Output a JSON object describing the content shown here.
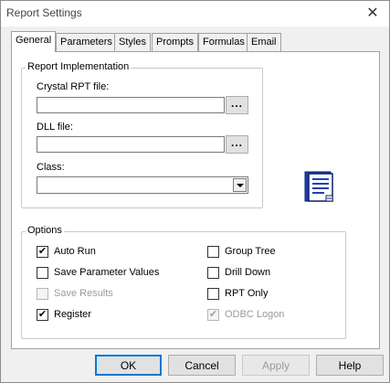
{
  "window": {
    "title": "Report Settings",
    "close_glyph": "✕"
  },
  "tabs": [
    {
      "label": "General",
      "active": true
    },
    {
      "label": "Parameters"
    },
    {
      "label": "Styles"
    },
    {
      "label": "Prompts"
    },
    {
      "label": "Formulas"
    },
    {
      "label": "Email"
    }
  ],
  "implementation": {
    "legend": "Report Implementation",
    "rpt_label": "Crystal RPT file:",
    "rpt_value": "",
    "rpt_browse": "...",
    "dll_label": "DLL file:",
    "dll_value": "",
    "dll_browse": "...",
    "class_label": "Class:",
    "class_value": "",
    "icon": "report-document-icon"
  },
  "options": {
    "legend": "Options",
    "items": [
      {
        "label": "Auto Run",
        "checked": true,
        "enabled": true
      },
      {
        "label": "Save Parameter Values",
        "checked": false,
        "enabled": true
      },
      {
        "label": "Save Results",
        "checked": false,
        "enabled": false
      },
      {
        "label": "Register",
        "checked": true,
        "enabled": true
      },
      {
        "label": "Group Tree",
        "checked": false,
        "enabled": true
      },
      {
        "label": "Drill Down",
        "checked": false,
        "enabled": true
      },
      {
        "label": "RPT Only",
        "checked": false,
        "enabled": true
      },
      {
        "label": "ODBC Logon",
        "checked": true,
        "enabled": false
      }
    ]
  },
  "buttons": {
    "ok": "OK",
    "cancel": "Cancel",
    "apply": "Apply",
    "help": "Help"
  },
  "check_glyph": "✔"
}
